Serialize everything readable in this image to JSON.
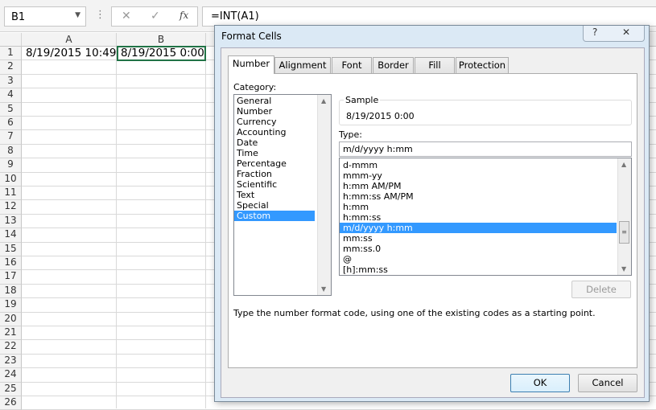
{
  "formula_bar": {
    "name_box": "B1",
    "cancel_icon": "✕",
    "enter_icon": "✓",
    "fx_label": "fx",
    "formula": "=INT(A1)"
  },
  "sheet": {
    "columns": [
      "A",
      "B"
    ],
    "rows": [
      "1",
      "2",
      "3",
      "4",
      "5",
      "6",
      "7",
      "8",
      "9",
      "10",
      "11",
      "12",
      "13",
      "14",
      "15",
      "16",
      "17",
      "18",
      "19",
      "20",
      "21",
      "22",
      "23",
      "24",
      "25",
      "26"
    ],
    "cells": {
      "A1": "8/19/2015 10:49",
      "B1": "8/19/2015 0:00"
    }
  },
  "dialog": {
    "title": "Format Cells",
    "help": "?",
    "close": "✕",
    "tabs": [
      "Number",
      "Alignment",
      "Font",
      "Border",
      "Fill",
      "Protection"
    ],
    "active_tab": "Number",
    "category_label": "Category:",
    "categories": [
      "General",
      "Number",
      "Currency",
      "Accounting",
      "Date",
      "Time",
      "Percentage",
      "Fraction",
      "Scientific",
      "Text",
      "Special",
      "Custom"
    ],
    "selected_category": "Custom",
    "sample_label": "Sample",
    "sample_value": "8/19/2015 0:00",
    "type_label": "Type:",
    "type_value": "m/d/yyyy h:mm",
    "formats": [
      "d-mmm",
      "mmm-yy",
      "h:mm AM/PM",
      "h:mm:ss AM/PM",
      "h:mm",
      "h:mm:ss",
      "m/d/yyyy h:mm",
      "mm:ss",
      "mm:ss.0",
      "@",
      "[h]:mm:ss"
    ],
    "selected_format": "m/d/yyyy h:mm",
    "delete_label": "Delete",
    "description": "Type the number format code, using one of the existing codes as a starting point.",
    "ok_label": "OK",
    "cancel_label": "Cancel"
  },
  "colors": {
    "selection": "#3399ff",
    "ok_border": "#3c7fb1"
  }
}
